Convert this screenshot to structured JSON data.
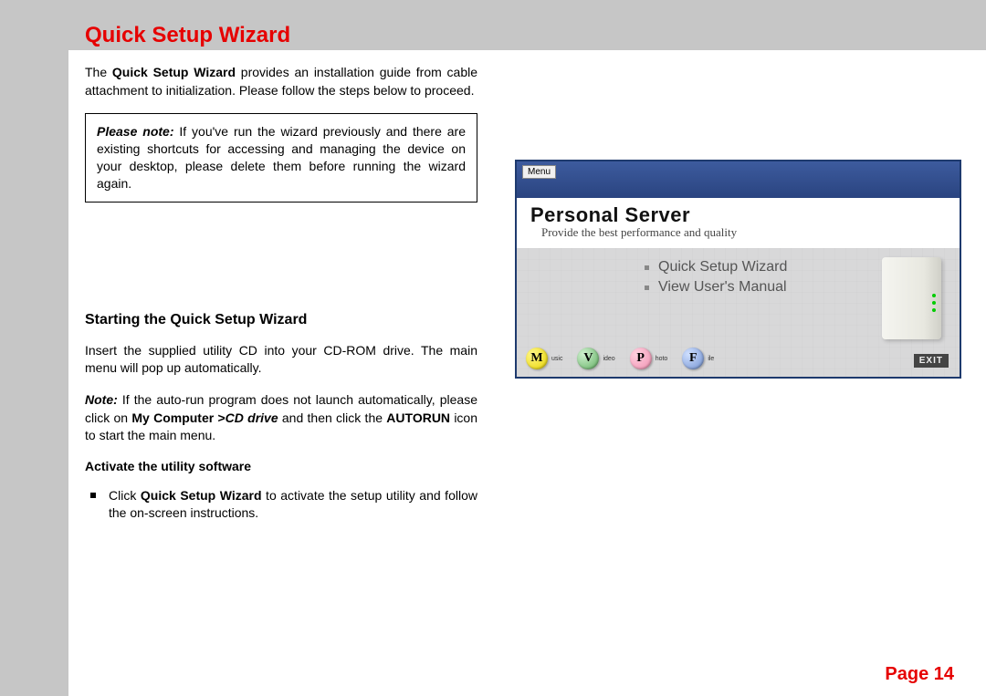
{
  "title": "Quick Setup Wizard",
  "intro": {
    "pre": "The ",
    "bold": "Quick Setup Wizard",
    "post": " provides an installation guide from cable attachment to initialization. Please follow the steps below to proceed."
  },
  "note": {
    "label": "Please note:",
    "text": " If you've run the wizard previously and there are existing shortcuts for accessing and managing the device on your desktop, please delete them before running the wizard again."
  },
  "section": "Starting the Quick Setup Wizard",
  "para1": "Insert the supplied utility CD into your CD-ROM drive. The main menu will pop up automatically.",
  "para2": {
    "notelabel": "Note:",
    "a": " If the auto-run program does not launch automatically, please click on ",
    "b": "My Computer >",
    "c": "CD drive",
    "d": " and then click the ",
    "e": "AUTORUN",
    "f": " icon to start the main menu."
  },
  "subhead": "Activate the utility software",
  "bullet": {
    "a": "Click ",
    "b": "Quick Setup Wizard",
    "c": " to activate the setup utility and follow the on-screen instructions."
  },
  "screenshot": {
    "menu": "Menu",
    "title": "Personal Server",
    "subtitle": "Provide the best performance and quality",
    "link1": "Quick Setup Wizard",
    "link2": "View User's Manual",
    "icons": {
      "m": "M",
      "m_sub": "usic",
      "v": "V",
      "v_sub": "ideo",
      "p": "P",
      "p_sub": "hoto",
      "f": "F",
      "f_sub": "ile"
    },
    "exit": "EXIT"
  },
  "page": "Page 14"
}
